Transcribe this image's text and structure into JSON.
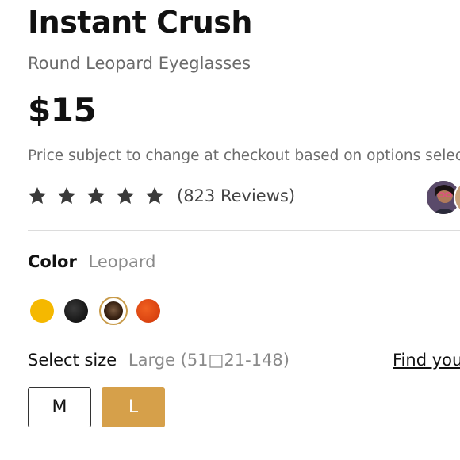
{
  "product": {
    "title": "Instant Crush",
    "subtitle": "Round Leopard Eyeglasses",
    "price": "$15",
    "price_note": "Price subject to change at checkout based on options selecte"
  },
  "rating": {
    "stars": 5,
    "max_stars": 5,
    "reviews_label": "(823 Reviews)"
  },
  "color": {
    "label": "Color",
    "selected": "Leopard",
    "swatches": [
      {
        "name": "yellow",
        "hex": "#f5b800"
      },
      {
        "name": "black",
        "hex": "#1a1a1a"
      },
      {
        "name": "leopard",
        "hex": "#3b2414",
        "selected": true
      },
      {
        "name": "orange",
        "hex": "#d94210"
      }
    ]
  },
  "size": {
    "label": "Select size",
    "selected": "Large (51□21-148)",
    "find_link": "Find you",
    "options": [
      "M",
      "L"
    ],
    "selected_option": "L"
  },
  "colors": {
    "accent": "#d6a04a",
    "text": "#111111",
    "muted": "#6b6b6b",
    "star": "#3a3a3a"
  }
}
